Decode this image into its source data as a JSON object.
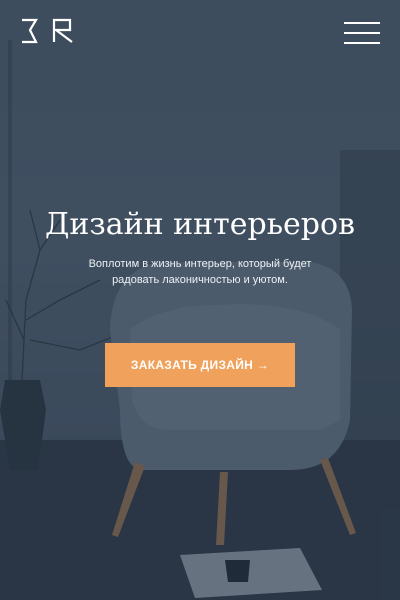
{
  "header": {
    "logo_text": "BR",
    "menu_icon": "hamburger-menu-icon"
  },
  "hero": {
    "title": "Дизайн интерьеров",
    "subtitle": "Воплотим в жизнь интерьер, который будет радовать лаконичностью и уютом.",
    "cta_label": "ЗАКАЗАТЬ ДИЗАЙН →",
    "colors": {
      "accent": "#f0a15b",
      "text": "#ffffff",
      "background": "#4a5a6b"
    }
  }
}
